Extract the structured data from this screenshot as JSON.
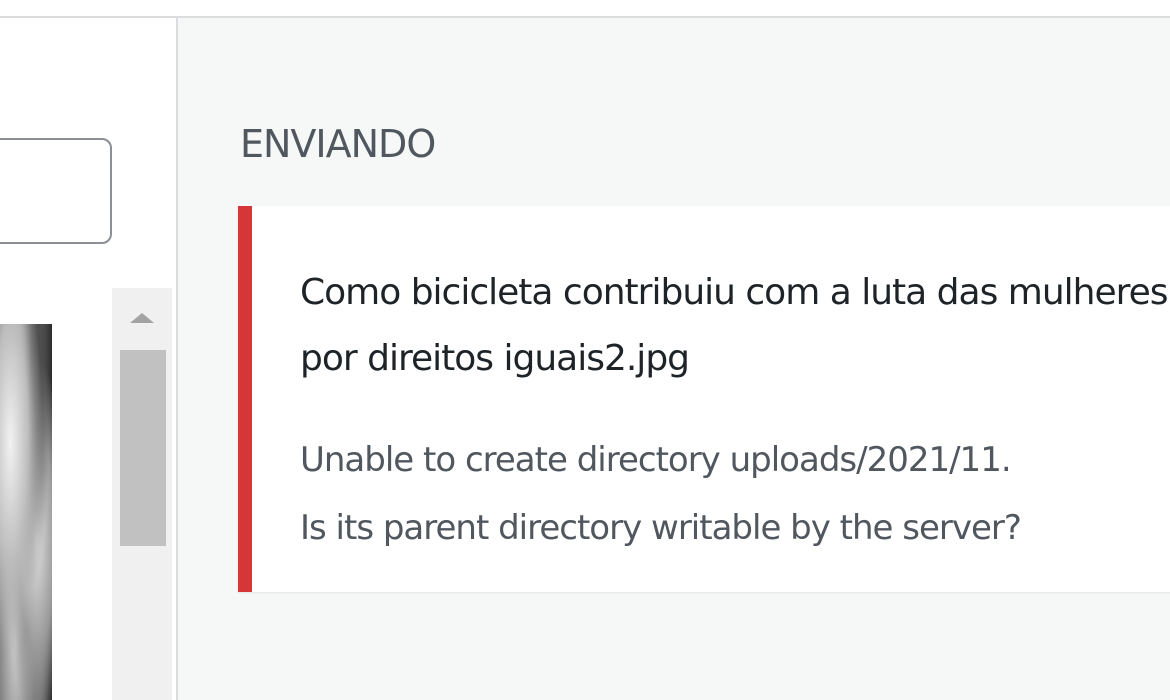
{
  "uploading": {
    "heading": "ENVIANDO",
    "error": {
      "filename": "Como bicicleta contribuiu com a luta das mulheres por direitos iguais2.jpg",
      "message_line1": "Unable to create directory uploads/2021/11.",
      "message_line2": "Is its parent directory writable by the server?"
    }
  },
  "library": {
    "search": {
      "value": ""
    }
  },
  "colors": {
    "error_accent": "#d63638",
    "panel_background": "#f6f7f7",
    "heading_text": "#50575e",
    "body_text": "#1d2327"
  },
  "icons": {
    "scroll_up": "triangle-up"
  }
}
